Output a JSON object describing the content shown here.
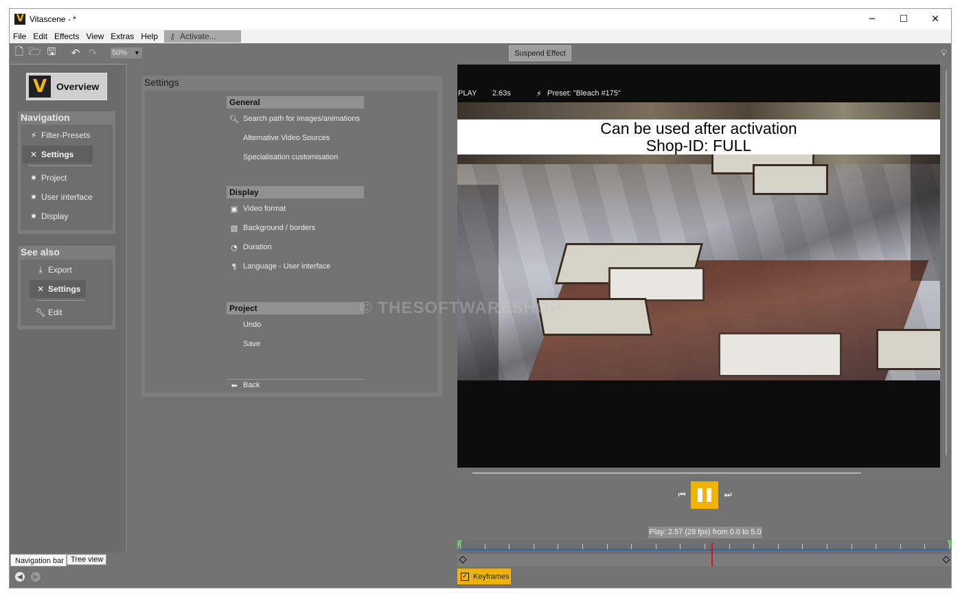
{
  "window": {
    "title": "Vitascene - *",
    "minimize": "─",
    "maximize": "☐",
    "close": "✕"
  },
  "menu": [
    "File",
    "Edit",
    "Effects",
    "View",
    "Extras",
    "Help"
  ],
  "activate": {
    "label": "Activate...",
    "icon": "key-icon"
  },
  "toolbar": {
    "zoom": "50%",
    "suspend_label": "Suspend Effect",
    "icons": [
      "new-file-icon",
      "open-folder-icon",
      "save-icon",
      "undo-icon",
      "redo-icon",
      "lightbulb-icon"
    ]
  },
  "overview": {
    "label": "Overview"
  },
  "navigation": {
    "title": "Navigation",
    "items": [
      {
        "label": "Filter-Presets",
        "icon": "lightning-icon"
      },
      {
        "label": "Settings",
        "icon": "tools-icon",
        "selected": true
      },
      {
        "label": "Project",
        "icon": "gear-icon"
      },
      {
        "label": "User interface",
        "icon": "gear-icon"
      },
      {
        "label": "Display",
        "icon": "gear-icon"
      }
    ]
  },
  "see_also": {
    "title": "See also",
    "items": [
      {
        "label": "Export",
        "icon": "export-icon"
      },
      {
        "label": "Settings",
        "icon": "tools-icon",
        "selected": true
      },
      {
        "label": "Edit",
        "icon": "wrench-icon"
      }
    ]
  },
  "panel_tabs": {
    "navigation_bar": "Navigation bar",
    "tree_view": "Tree view"
  },
  "settings": {
    "title": "Settings",
    "general": {
      "header": "General",
      "items": [
        "Search path for images/animations",
        "Alternative Video Sources",
        "Specialisation customisation"
      ]
    },
    "display": {
      "header": "Display",
      "items": [
        "Video format",
        "Background / borders",
        "Duration",
        "Language - User interface"
      ]
    },
    "project": {
      "header": "Project",
      "items": [
        "Undo",
        "Save"
      ]
    },
    "back": "Back"
  },
  "preview": {
    "state": "PLAY",
    "time": "2.63s",
    "preset": "Preset: \"Bleach #175\"",
    "banner_line1": "Can be used after activation",
    "banner_line2": "Shop-ID:  FULL",
    "watermark": "© THESOFTWARESHOP"
  },
  "playback": {
    "status": "Play: 2.57 (28 fps) from 0.0 to 5.0",
    "keyframes_label": "Keyframes",
    "keyframes_checked": true,
    "position": 2.57,
    "start": 0.0,
    "end": 5.0
  },
  "colors": {
    "accent": "#f0b400",
    "timeline_track": "#3c64b4",
    "cursor": "#e01010"
  }
}
